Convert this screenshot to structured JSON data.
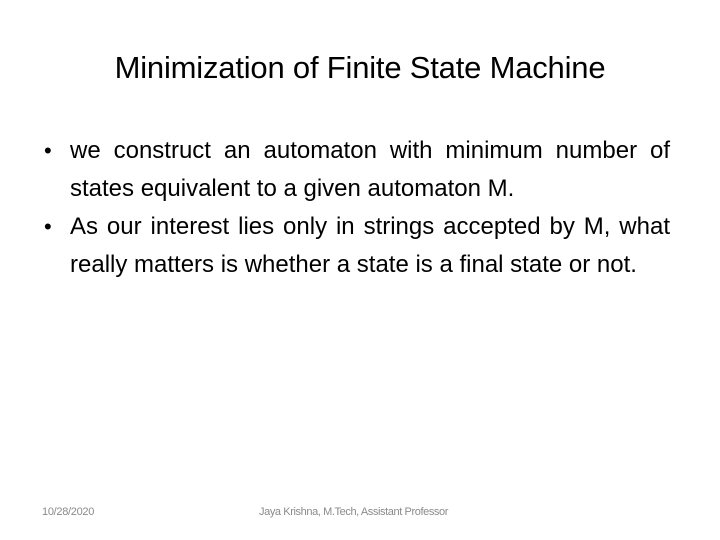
{
  "slide": {
    "title": "Minimization of Finite State Machine",
    "bullets": [
      {
        "marker": "•",
        "text": "we construct an automaton with minimum number of states equivalent to a given automaton M."
      },
      {
        "marker": "•",
        "text": "As our interest lies only in strings accepted by M, what really matters is whether a state is a final state or not."
      }
    ]
  },
  "footer": {
    "date": "10/28/2020",
    "author": "Jaya Krishna, M.Tech, Assistant Professor"
  }
}
